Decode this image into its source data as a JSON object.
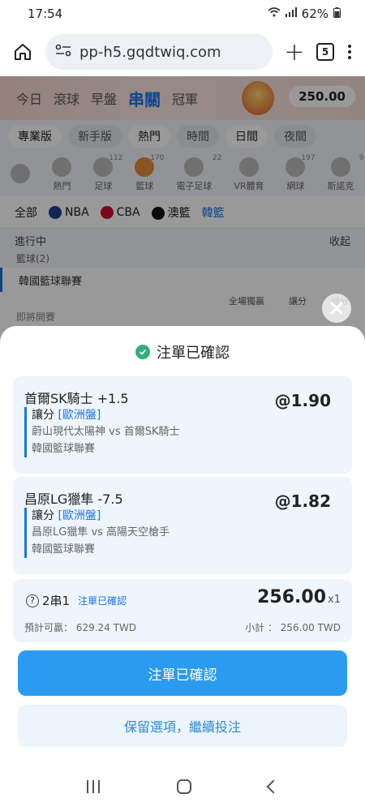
{
  "status_bar": {
    "time": "17:54",
    "battery": "62%"
  },
  "browser": {
    "url": "pp-h5.gqdtwiq.com",
    "tab_count": "5"
  },
  "background": {
    "top_tabs": [
      "今日",
      "滾球",
      "早盤",
      "串關",
      "冠軍"
    ],
    "balance": "250.00",
    "filters": [
      "專業版",
      "新手版",
      "熱門",
      "時間",
      "日間",
      "夜間"
    ],
    "sports": [
      {
        "label": "",
        "count": ""
      },
      {
        "label": "熱門",
        "count": ""
      },
      {
        "label": "足球",
        "count": "112"
      },
      {
        "label": "籃球",
        "count": "170"
      },
      {
        "label": "電子足球",
        "count": "22"
      },
      {
        "label": "VR體育",
        "count": ""
      },
      {
        "label": "網球",
        "count": "197"
      },
      {
        "label": "斯諾克",
        "count": "9"
      }
    ],
    "leagues": [
      "全部",
      "NBA",
      "CBA",
      "澳籃",
      "韓籃"
    ],
    "live_label": "進行中",
    "collapse_label": "收起",
    "sport_count": "籃球(2)",
    "competition": "韓國籃球聯賽",
    "columns": [
      "全場獨贏",
      "讓分",
      "總分"
    ],
    "coming_soon": "即將開賽"
  },
  "sheet": {
    "title": "注單已確認",
    "selections": [
      {
        "title": "首爾SK騎士 +1.5",
        "odds": "@1.90",
        "market": "讓分",
        "market_tag": "[歐洲盤]",
        "match": "蔚山現代太陽神 vs 首爾SK騎士",
        "league": "韓國籃球聯賽"
      },
      {
        "title": "昌原LG獵隼 -7.5",
        "odds": "@1.82",
        "market": "讓分",
        "market_tag": "[歐洲盤]",
        "match": "昌原LG獵隼 vs 高陽天空槍手",
        "league": "韓國籃球聯賽"
      }
    ],
    "summary": {
      "parlay": "2串1",
      "status": "注單已確認",
      "amount": "256.00",
      "multiplier": "x1",
      "estimate": "預計可贏： 629.24 TWD",
      "subtotal": "小計 ： 256.00 TWD"
    },
    "primary_button": "注單已確認",
    "secondary_button": "保留選項，繼續投注"
  }
}
